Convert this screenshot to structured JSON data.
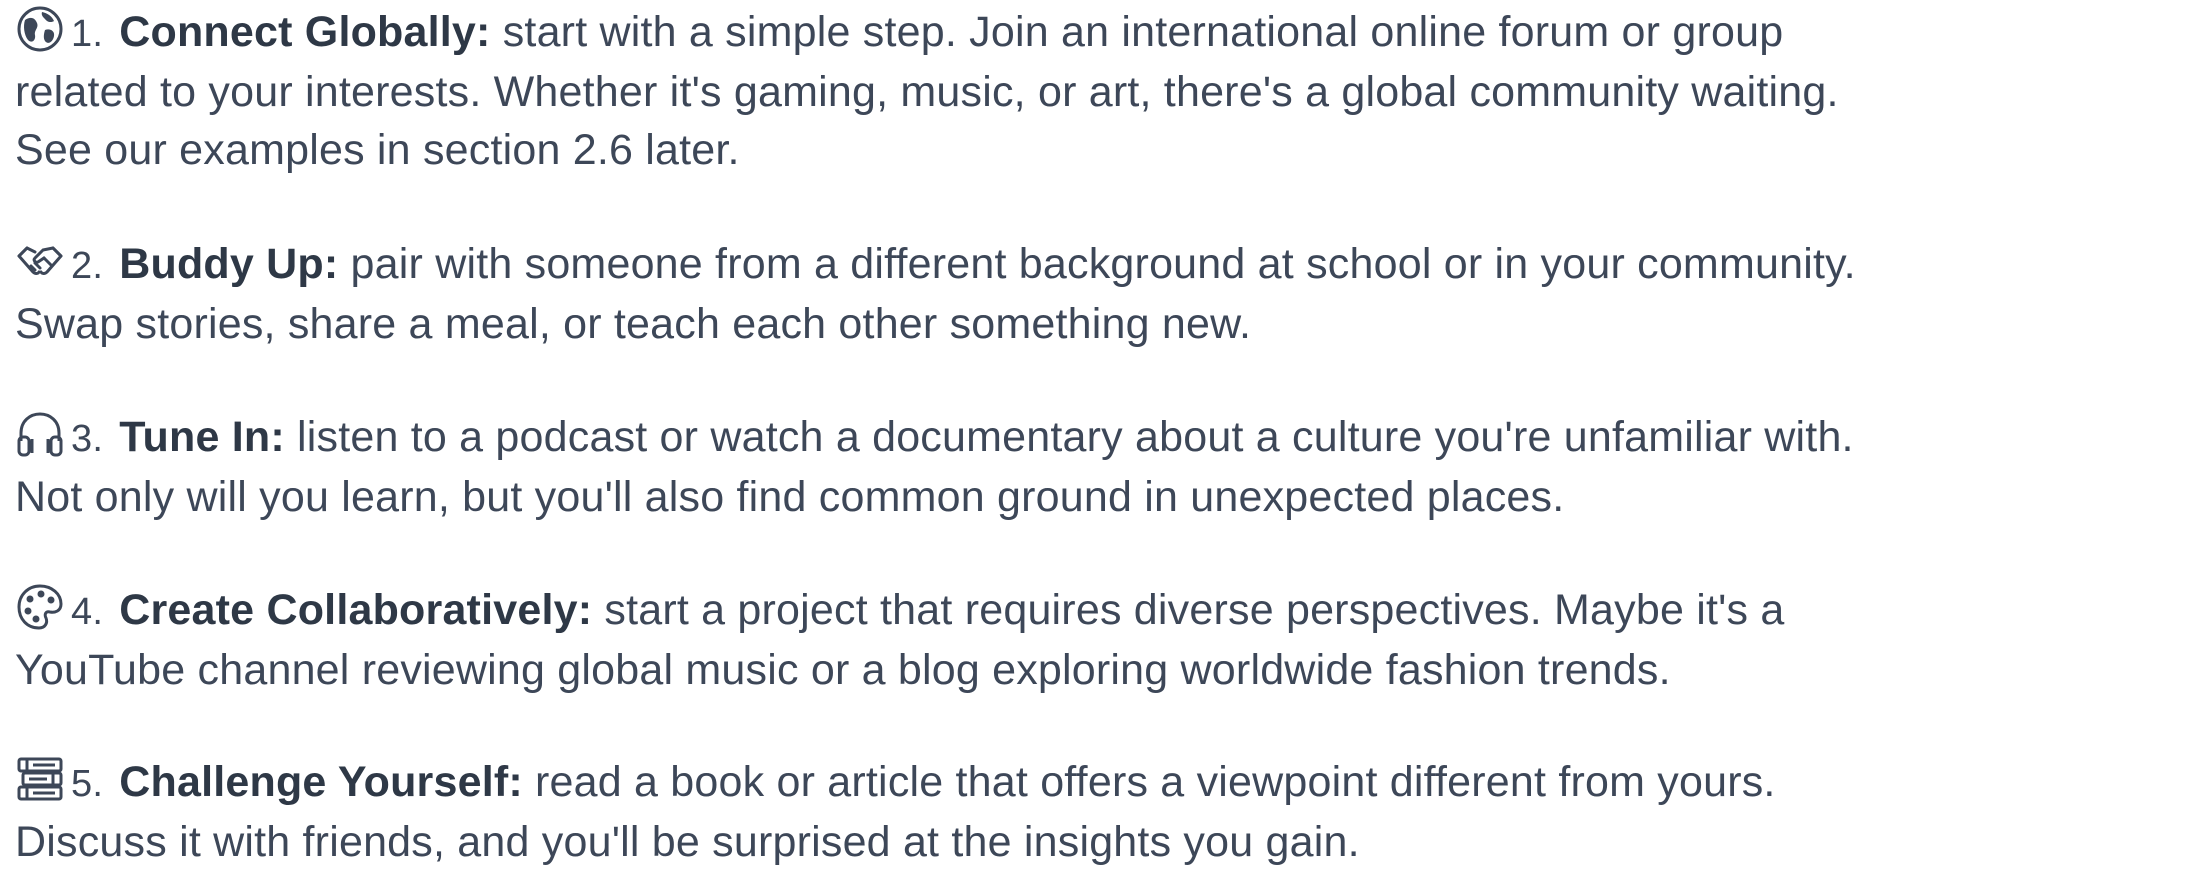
{
  "items": [
    {
      "icon": "globe-icon",
      "number": "1.",
      "heading": "Connect Globally:",
      "lines": [
        " start with a simple step. Join an international online forum or group",
        "related to your interests. Whether it's gaming, music, or art, there's a global community waiting.",
        "See our examples in section 2.6 later."
      ]
    },
    {
      "icon": "handshake-icon",
      "number": "2.",
      "heading": "Buddy Up:",
      "lines": [
        " pair with someone from a different background at school or in your community.",
        "Swap stories, share a meal, or teach each other something new."
      ]
    },
    {
      "icon": "headphones-icon",
      "number": "3.",
      "heading": "Tune In:",
      "lines": [
        " listen to a podcast or watch a documentary about a culture you're unfamiliar with.",
        "Not only will you learn, but you'll also find common ground in unexpected places."
      ]
    },
    {
      "icon": "palette-icon",
      "number": "4.",
      "heading": "Create Collaboratively:",
      "lines": [
        " start a project that requires diverse perspectives. Maybe it's a",
        "YouTube channel reviewing global music or a blog exploring worldwide fashion trends."
      ]
    },
    {
      "icon": "books-icon",
      "number": "5.",
      "heading": "Challenge Yourself:",
      "lines": [
        " read a book or article that offers a viewpoint different from yours.",
        "Discuss it with friends, and you'll be surprised at the insights you gain."
      ]
    }
  ],
  "colors": {
    "text": "#3d4758",
    "heading": "#2e3846",
    "icon_stroke": "#3d4758"
  }
}
